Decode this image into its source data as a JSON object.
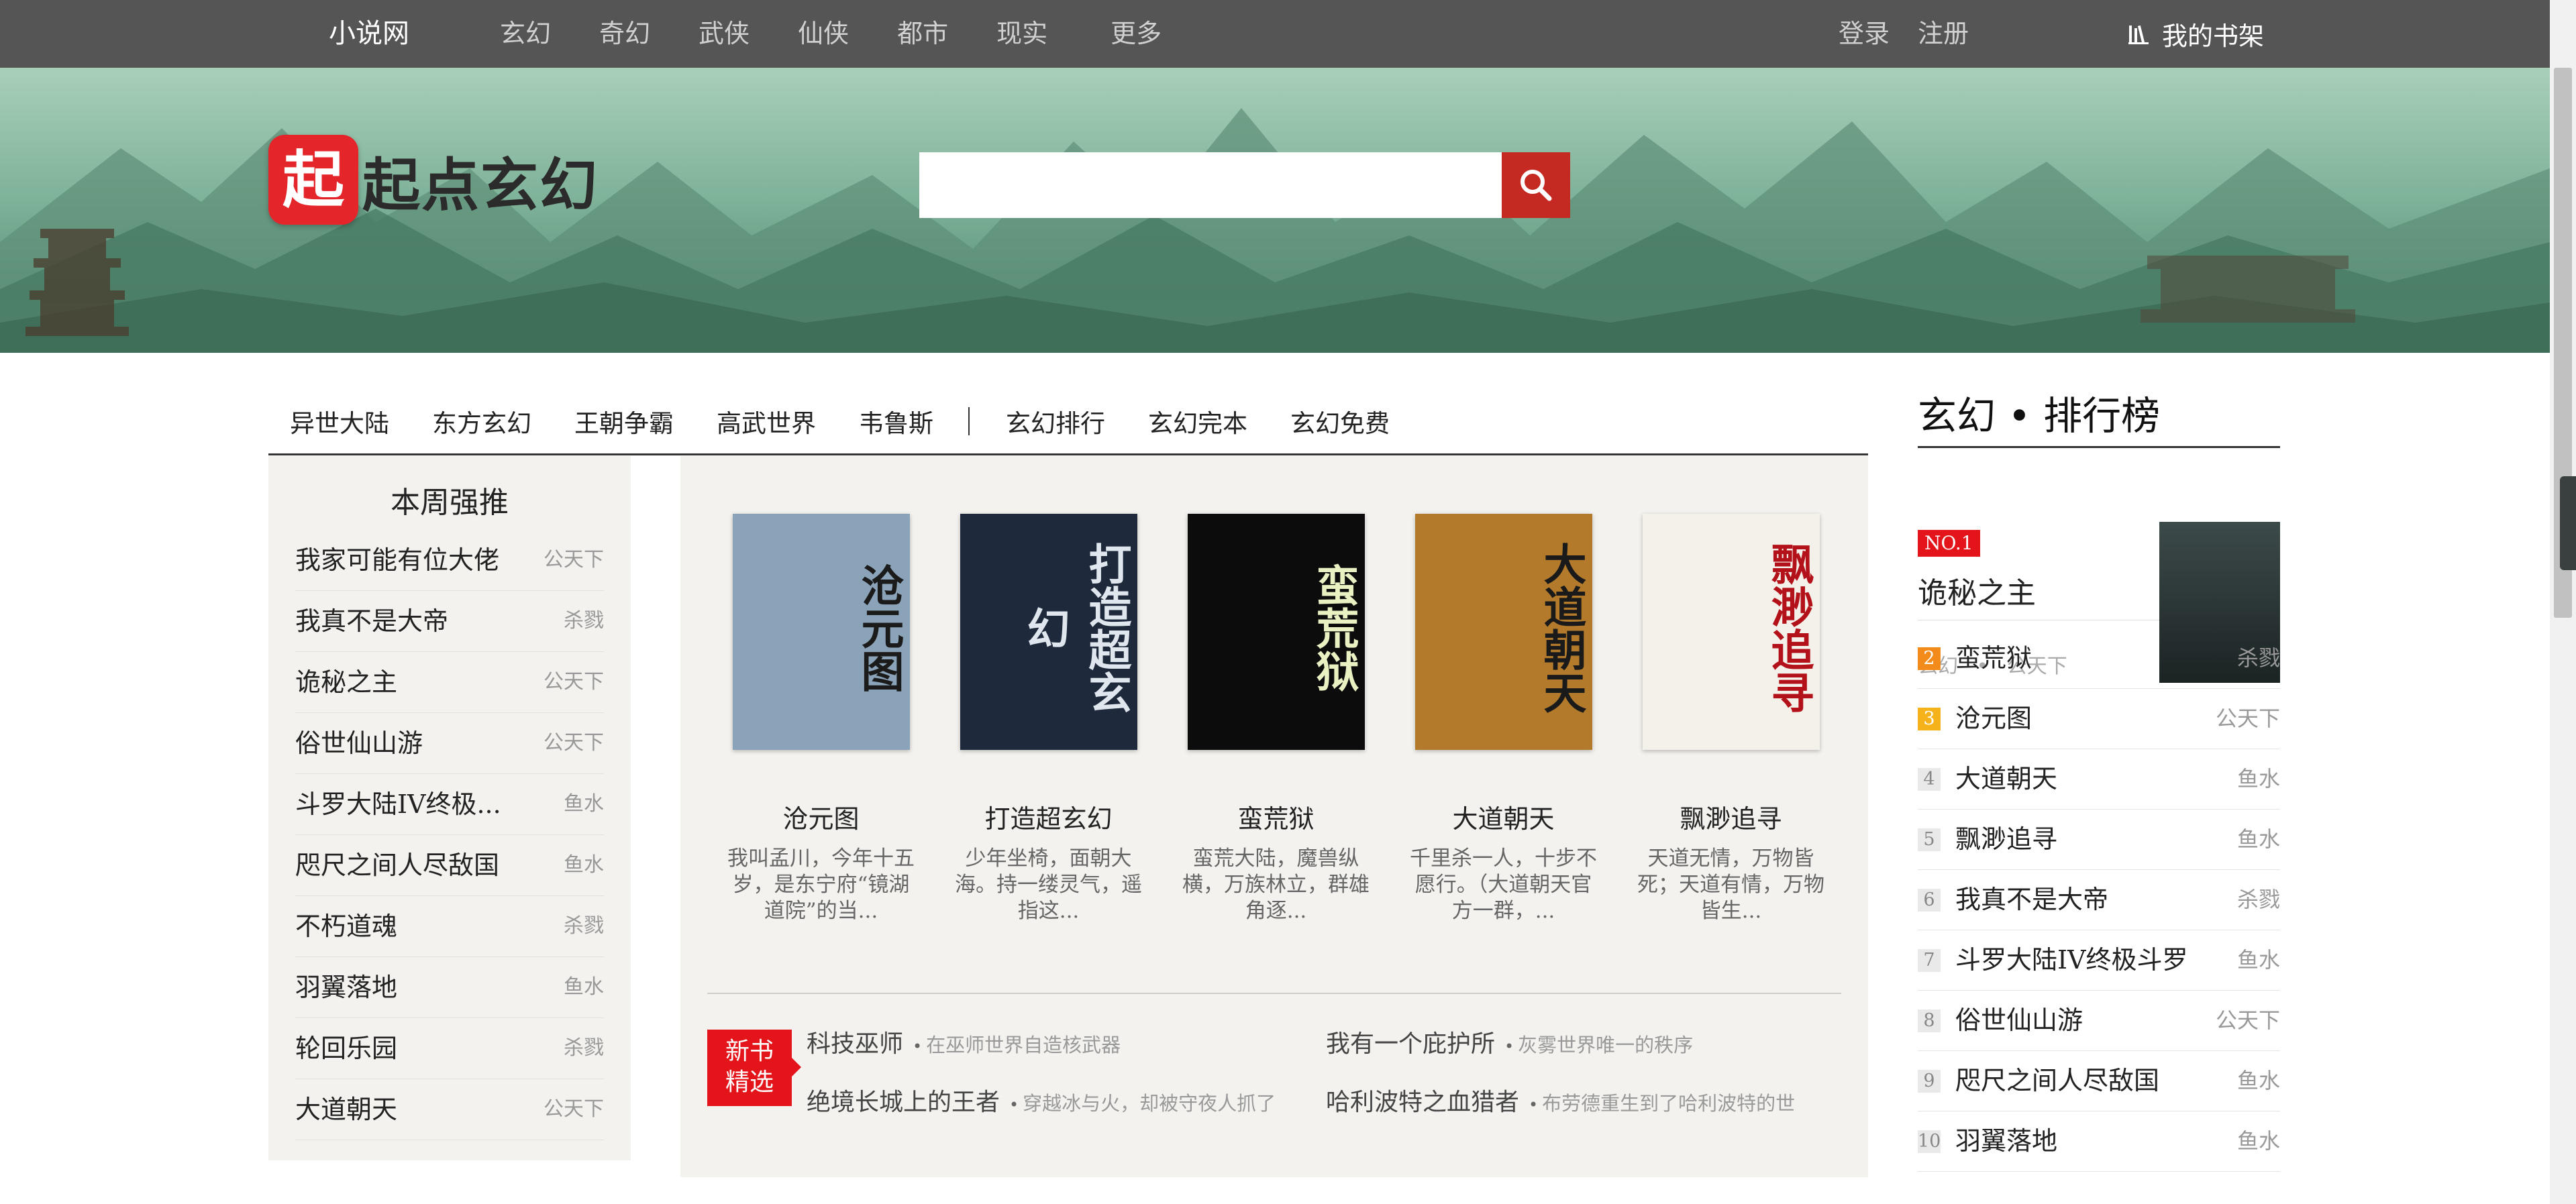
{
  "topnav": {
    "site": "小说网",
    "categories": [
      "玄幻",
      "奇幻",
      "武侠",
      "仙侠",
      "都市",
      "现实"
    ],
    "more": "更多",
    "login": "登录",
    "register": "注册",
    "bookshelf": "我的书架"
  },
  "header": {
    "logo_mark": "起",
    "logo_name": "起点玄幻",
    "search_placeholder": ""
  },
  "subnav": {
    "left": [
      "异世大陆",
      "东方玄幻",
      "王朝争霸",
      "高武世界",
      "韦鲁斯"
    ],
    "right": [
      "玄幻排行",
      "玄幻完本",
      "玄幻免费"
    ]
  },
  "weekly": {
    "title": "本周强推",
    "items": [
      {
        "title": "我家可能有位大佬",
        "author": "公天下"
      },
      {
        "title": "我真不是大帝",
        "author": "杀戮"
      },
      {
        "title": "诡秘之主",
        "author": "公天下"
      },
      {
        "title": "俗世仙山游",
        "author": "公天下"
      },
      {
        "title": "斗罗大陆IV终极...",
        "author": "鱼水"
      },
      {
        "title": "咫尺之间人尽敌国",
        "author": "鱼水"
      },
      {
        "title": "不朽道魂",
        "author": "杀戮"
      },
      {
        "title": "羽翼落地",
        "author": "鱼水"
      },
      {
        "title": "轮回乐园",
        "author": "杀戮"
      },
      {
        "title": "大道朝天",
        "author": "公天下"
      }
    ]
  },
  "featured": [
    {
      "title": "沧元图",
      "desc": "我叫孟川，今年十五岁，是东宁府“镜湖道院”的当...",
      "cover_text": "沧元图",
      "cover_bg": "#8aa3b8",
      "cover_fg": "#1b1b1b"
    },
    {
      "title": "打造超玄幻",
      "desc": "少年坐椅，面朝大海。持一缕灵气，遥指这...",
      "cover_text": "打造超玄幻",
      "cover_bg": "#1e2a3b",
      "cover_fg": "#dfe6ee"
    },
    {
      "title": "蛮荒狱",
      "desc": "蛮荒大陆，魔兽纵横，万族林立，群雄角逐...",
      "cover_text": "蛮荒狱",
      "cover_bg": "#0c0c0c",
      "cover_fg": "#e9f0c2"
    },
    {
      "title": "大道朝天",
      "desc": "千里杀一人，十步不愿行。（大道朝天官方一群，...",
      "cover_text": "大道朝天",
      "cover_bg": "#b27a2a",
      "cover_fg": "#1a1a1a"
    },
    {
      "title": "飘渺追寻",
      "desc": "天道无情，万物皆死；天道有情，万物皆生...",
      "cover_text": "飘渺追寻",
      "cover_bg": "#f4f1ea",
      "cover_fg": "#b3121a"
    }
  ],
  "new_books": {
    "badge_line1": "新书",
    "badge_line2": "精选",
    "items": [
      {
        "title": "科技巫师",
        "desc": "在巫师世界自造核武器"
      },
      {
        "title": "我有一个庇护所",
        "desc": "灰雾世界唯一的秩序"
      },
      {
        "title": "绝境长城上的王者",
        "desc": "穿越冰与火，却被守夜人抓了"
      },
      {
        "title": "哈利波特之血猎者",
        "desc": "布劳德重生到了哈利波特的世"
      }
    ]
  },
  "ranking": {
    "title": "玄幻 • 排行榜",
    "first": {
      "badge": "NO.1",
      "title": "诡秘之主",
      "category": "玄幻",
      "dot": "•",
      "author": "公天下"
    },
    "items": [
      {
        "n": "2",
        "title": "蛮荒狱",
        "author": "杀戮"
      },
      {
        "n": "3",
        "title": "沧元图",
        "author": "公天下"
      },
      {
        "n": "4",
        "title": "大道朝天",
        "author": "鱼水"
      },
      {
        "n": "5",
        "title": "飘渺追寻",
        "author": "鱼水"
      },
      {
        "n": "6",
        "title": "我真不是大帝",
        "author": "杀戮"
      },
      {
        "n": "7",
        "title": "斗罗大陆IV终极斗罗",
        "author": "鱼水"
      },
      {
        "n": "8",
        "title": "俗世仙山游",
        "author": "公天下"
      },
      {
        "n": "9",
        "title": "咫尺之间人尽敌国",
        "author": "鱼水"
      },
      {
        "n": "10",
        "title": "羽翼落地",
        "author": "鱼水"
      }
    ]
  },
  "colors": {
    "topnav_bg": "#555555",
    "accent_red": "#e4141b",
    "search_button": "#c52a22",
    "rank2": "#f28b1a",
    "rank3": "#f5b21b",
    "panel_bg": "#f3f2ee"
  }
}
